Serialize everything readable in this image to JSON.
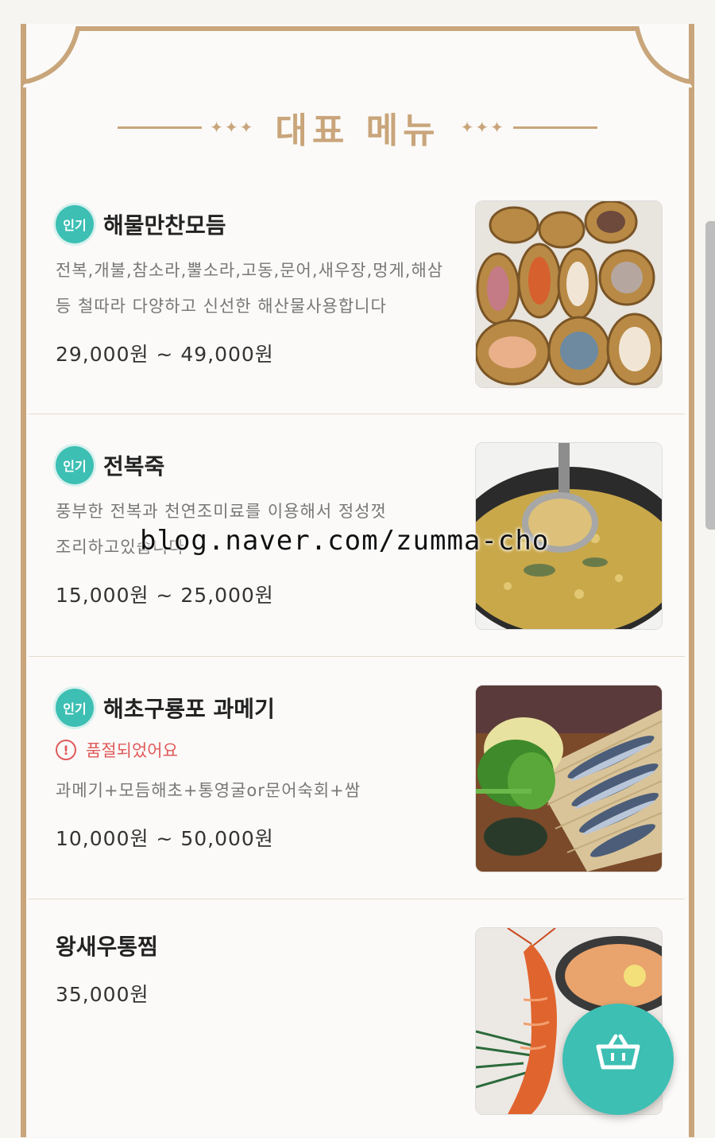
{
  "section": {
    "title": "대표 메뉴",
    "title_ornament": "✦✦✦"
  },
  "items": [
    {
      "badge": "인기",
      "name": "해물만찬모듬",
      "description": "전복,개불,참소라,뿔소라,고동,문어,새우장,멍게,해삼 등 철따라 다양하고 신선한 해산물사용합니다",
      "price": "29,000원 ~ 49,000원",
      "image": "seafood-platter-photo"
    },
    {
      "badge": "인기",
      "name": "전복죽",
      "description": "풍부한 전복과 천연조미료를 이용해서 정성껏 조리하고있습니다",
      "price": "15,000원 ~ 25,000원",
      "image": "abalone-porridge-photo"
    },
    {
      "badge": "인기",
      "name": "해초구룡포 과메기",
      "soldout": "품절되었어요",
      "description": "과메기+모듬해초+통영굴or문어숙회+쌈",
      "price": "10,000원 ~ 50,000원",
      "image": "gwamegi-photo"
    },
    {
      "name": "왕새우통찜",
      "price": "35,000원",
      "image": "steamed-prawn-photo"
    }
  ],
  "watermark": "blog.naver.com/zumma-cho",
  "cart": {
    "icon": "basket-icon"
  },
  "colors": {
    "accent": "#c9a57b",
    "badge": "#3dbfb3",
    "soldout": "#e05a5a"
  }
}
